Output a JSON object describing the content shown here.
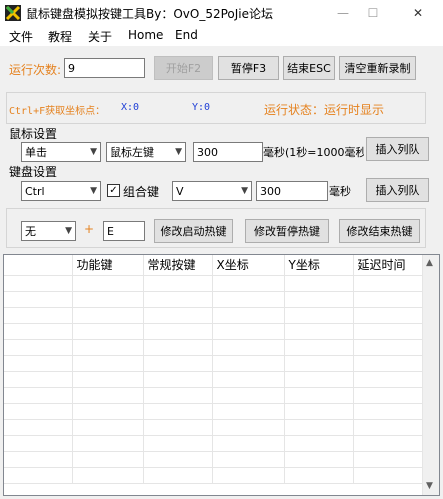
{
  "window": {
    "title": "鼠标键盘模拟按键工具By：OvO_52PoJie论坛",
    "controls": {
      "minimize": "—",
      "maximize": "☐",
      "close": "✕"
    }
  },
  "menu": [
    "文件",
    "教程",
    "关于",
    "Home",
    "End"
  ],
  "run": {
    "count_label": "运行次数:",
    "count_value": "9",
    "start_btn": "开始F2",
    "pause_btn": "暂停F3",
    "end_btn": "结束ESC",
    "clear_btn": "清空重新录制"
  },
  "coords": {
    "hint": "Ctrl+F获取坐标点：",
    "x": "X:0",
    "y": "Y:0",
    "status_label": "运行状态：",
    "status_value": "运行时显示"
  },
  "mouse": {
    "group_label": "鼠标设置",
    "click_type": "单击",
    "button": "鼠标左键",
    "delay": "300",
    "unit_hint": "毫秒(1秒=1000毫秒)",
    "insert_btn": "插入列队"
  },
  "keyboard": {
    "group_label": "键盘设置",
    "modifier": "Ctrl",
    "combo_label": "组合键",
    "combo_checked": "✓",
    "key": "V",
    "delay": "300",
    "unit": "毫秒",
    "insert_btn": "插入列队"
  },
  "hotkeys": {
    "modifier": "无",
    "plus": "+",
    "key": "E",
    "change_start": "修改启动热键",
    "change_pause": "修改暂停热键",
    "change_end": "修改结束热键"
  },
  "table": {
    "columns": [
      "",
      "功能键",
      "常规按键",
      "X坐标",
      "Y坐标",
      "延迟时间"
    ],
    "scroll_up": "▲",
    "scroll_down": "▼"
  },
  "colors": {
    "orange": "#e5821f",
    "blue": "#1f3fd6",
    "red_plus": "#e5821f"
  }
}
